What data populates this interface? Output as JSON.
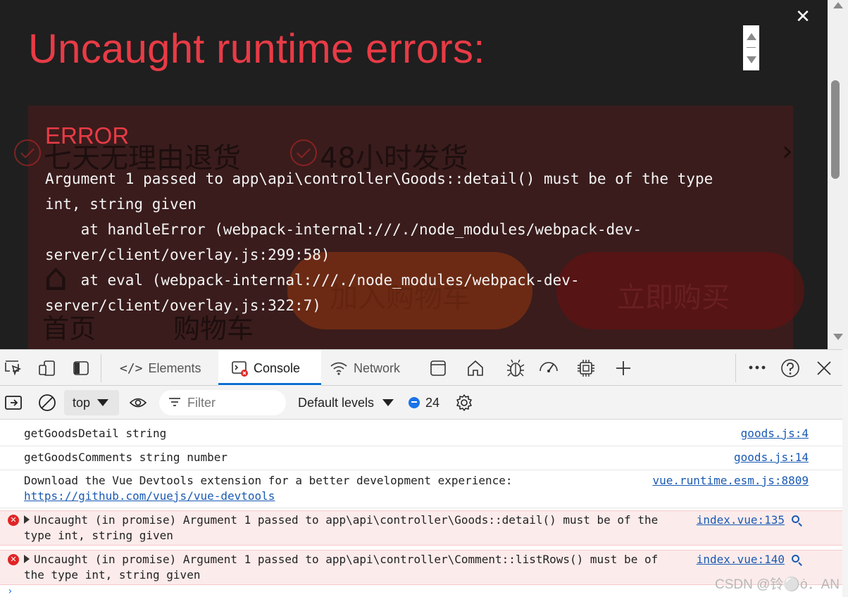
{
  "overlay": {
    "title": "Uncaught runtime errors:",
    "close_glyph": "✕",
    "error_heading": "ERROR",
    "error_message": "Argument 1 passed to app\\api\\controller\\Goods::detail() must be of the type int, string given\n    at handleError (webpack-internal:///./node_modules/webpack-dev-server/client/overlay.js:299:58)\n    at eval (webpack-internal:///./node_modules/webpack-dev-server/client/overlay.js:322:7)"
  },
  "page_behind": {
    "badge_1": "七天无理由退货",
    "badge_2": "48小时发货",
    "nav_home": "首页",
    "nav_cart": "购物车",
    "add_to_cart": "加入购物车",
    "buy_now": "立即购买"
  },
  "devtools": {
    "tabs": [
      {
        "label": "Elements",
        "icon": "code-icon"
      },
      {
        "label": "Console",
        "icon": "console-icon",
        "active": true
      },
      {
        "label": "Network",
        "icon": "wifi-icon"
      }
    ],
    "toolbar": {
      "context": "top",
      "filter_placeholder": "Filter",
      "levels": "Default levels",
      "message_count": "24"
    },
    "console": [
      {
        "type": "log",
        "text": "getGoodsDetail string",
        "source": "goods.js:4"
      },
      {
        "type": "log",
        "text": "getGoodsComments string number",
        "source": "goods.js:14"
      },
      {
        "type": "log",
        "text": "Download the Vue Devtools extension for a better development experience:",
        "link": "https://github.com/vuejs/vue-devtools",
        "source": "vue.runtime.esm.js:8809"
      },
      {
        "type": "error",
        "text": "Uncaught (in promise) Argument 1 passed to app\\api\\controller\\Goods::detail() must be of the\ntype int, string given",
        "source": "index.vue:135"
      },
      {
        "type": "error",
        "text": "Uncaught (in promise) Argument 1 passed to app\\api\\controller\\Comment::listRows() must be of\nthe type int, string given",
        "source": "index.vue:140"
      }
    ],
    "watermark": "CSDN @铃⚪ȯ．AN"
  },
  "colors": {
    "overlay_bg": "#1f1f1f",
    "error_red": "#e83b46",
    "error_card": "#3a1c1c",
    "console_error_bg": "#fcebeb",
    "link_blue": "#1a5ab3",
    "active_tab_accent": "#0b6fcf"
  }
}
